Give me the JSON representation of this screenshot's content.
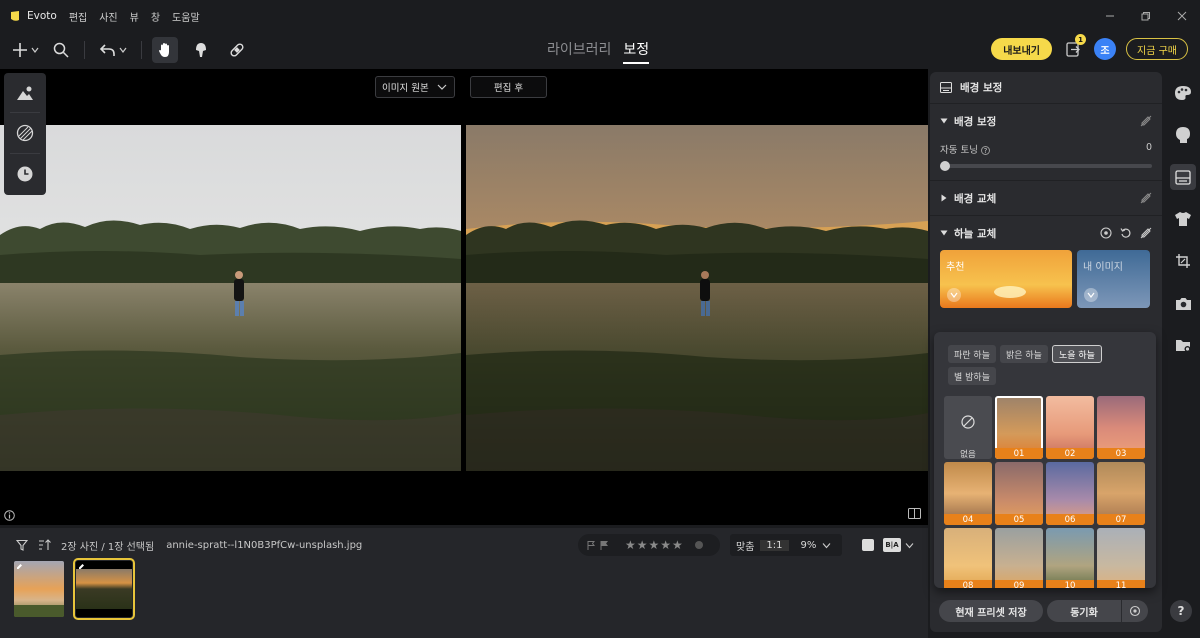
{
  "app": {
    "name": "Evoto",
    "menu": [
      "편집",
      "사진",
      "뷰",
      "창",
      "도움말"
    ]
  },
  "toolbar": {
    "tabs": {
      "library": "라이브러리",
      "edit": "보정"
    },
    "export_label": "내보내기",
    "queue_badge": "1",
    "avatar_initial": "조",
    "buy_label": "지금 구매"
  },
  "canvas": {
    "view_select": "이미지 원본",
    "after_label": "편집 후"
  },
  "filmstrip": {
    "count_text": "2장 사진 / 1장 선택됨",
    "file_name": "annie-spratt--l1N0B3PfCw-unsplash.jpg",
    "zoom_fit": "맞춤",
    "zoom_one": "1:1",
    "zoom_value": "9%"
  },
  "panel": {
    "header": "배경 보정",
    "sec_bg_adjust": "배경 보정",
    "auto_toning_label": "자동 토닝",
    "auto_toning_value": "0",
    "sec_bg_replace": "배경 교체",
    "sec_sky_replace": "하늘 교체",
    "card_recommended": "추천",
    "card_my_images": "내 이미지",
    "chips": [
      "파란 하늘",
      "밝은 하늘",
      "노을 하늘",
      "별 밤하늘"
    ],
    "grid_none": "없음",
    "grid_items": [
      "01",
      "02",
      "03",
      "04",
      "05",
      "06",
      "07",
      "08",
      "09",
      "10",
      "11"
    ],
    "save_preset": "현재 프리셋 저장",
    "sync": "동기화"
  },
  "help": "?",
  "colors": {
    "accent_yellow": "#f6d94a",
    "sky_orange": "#e8811a",
    "avatar_blue": "#3b82f6"
  }
}
